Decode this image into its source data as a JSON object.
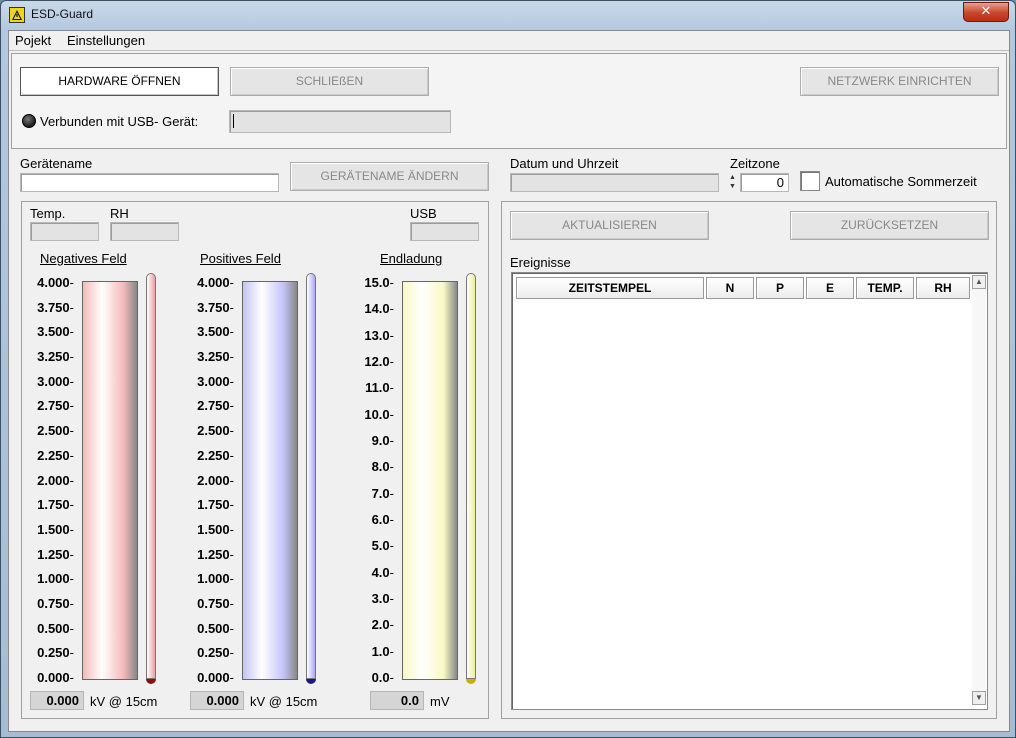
{
  "window": {
    "title": "ESD-Guard",
    "close_label": "✕"
  },
  "menu": [
    "Pojekt",
    "Einstellungen"
  ],
  "top": {
    "btn_open": "HARDWARE ÖFFNEN",
    "btn_close": "SCHLIEßEN",
    "btn_network": "NETZWERK EINRICHTEN",
    "usb_label": "Verbunden mit USB- Gerät:",
    "usb_value": ""
  },
  "device": {
    "name_label": "Gerätename",
    "name_value": "",
    "btn_rename": "GERÄTENAME ÄNDERN",
    "datetime_label": "Datum und Uhrzeit",
    "datetime_value": "",
    "tz_label": "Zeitzone",
    "tz_value": "0",
    "dst_label": "Automatische Sommerzeit"
  },
  "meters": {
    "temp_label": "Temp.",
    "rh_label": "RH",
    "usb_label": "USB",
    "negative": {
      "title": "Negatives Feld",
      "ticks": [
        "4.000",
        "3.750",
        "3.500",
        "3.250",
        "3.000",
        "2.750",
        "2.500",
        "2.250",
        "2.000",
        "1.750",
        "1.500",
        "1.250",
        "1.000",
        "0.750",
        "0.500",
        "0.250",
        "0.000"
      ],
      "value": 0,
      "readout": "0.000",
      "unit": "kV @ 15cm",
      "fill_color": "#f6b9b9",
      "thin_color": "#e8a1a1",
      "bulb_color": "#8b1010"
    },
    "positive": {
      "title": "Positives Feld",
      "ticks": [
        "4.000",
        "3.750",
        "3.500",
        "3.250",
        "3.000",
        "2.750",
        "2.500",
        "2.250",
        "2.000",
        "1.750",
        "1.500",
        "1.250",
        "1.000",
        "0.750",
        "0.500",
        "0.250",
        "0.000"
      ],
      "value": 0,
      "readout": "0.000",
      "unit": "kV @ 15cm",
      "fill_color": "#c3c3f8",
      "thin_color": "#a9a9ee",
      "bulb_color": "#1a1a8a"
    },
    "discharge": {
      "title": "Endladung",
      "ticks": [
        "15.0",
        "14.0",
        "13.0",
        "12.0",
        "11.0",
        "10.0",
        "9.0",
        "8.0",
        "7.0",
        "6.0",
        "5.0",
        "4.0",
        "3.0",
        "2.0",
        "1.0",
        "0.0"
      ],
      "value": 0,
      "readout": "0.0",
      "unit": "mV",
      "fill_color": "#f9f9c4",
      "thin_color": "#eded99",
      "bulb_color": "#c8b000"
    }
  },
  "events": {
    "btn_refresh": "AKTUALISIEREN",
    "btn_reset": "ZURÜCKSETZEN",
    "label": "Ereignisse",
    "columns": [
      "ZEITSTEMPEL",
      "N",
      "P",
      "E",
      "TEMP.",
      "RH"
    ],
    "rows": []
  }
}
